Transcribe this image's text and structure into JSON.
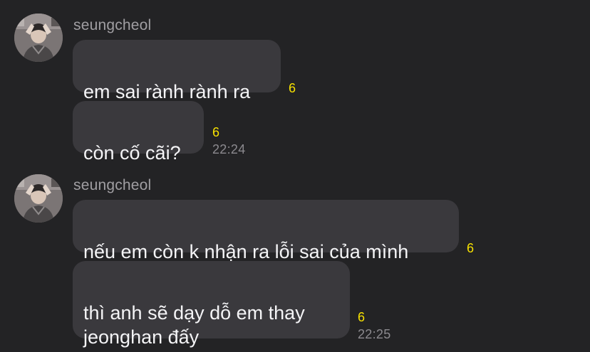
{
  "groups": [
    {
      "sender": "seungcheol",
      "messages": [
        {
          "text": "em sai rành rành ra",
          "unread": "6"
        },
        {
          "text": "còn cố cãi?",
          "unread": "6",
          "time": "22:24"
        }
      ]
    },
    {
      "sender": "seungcheol",
      "messages": [
        {
          "text": "nếu em còn k nhận ra lỗi sai của mình",
          "unread": "6"
        },
        {
          "text": "thì anh sẽ dạy dỗ em thay\njeonghan đấy",
          "unread": "6",
          "time": "22:25"
        }
      ]
    }
  ],
  "colors": {
    "background": "#232325",
    "bubble": "#3a393d",
    "unread": "#f7e100",
    "sender": "#a09ea2",
    "time": "#8c8a8f"
  }
}
